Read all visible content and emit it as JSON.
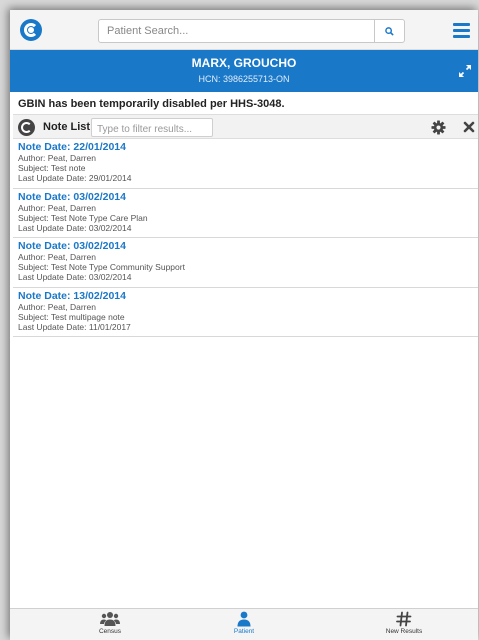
{
  "header": {
    "search_placeholder": "Patient Search...",
    "logo_icon": "app-logo-icon",
    "search_icon": "search-icon",
    "menu_icon": "hamburger-menu-icon"
  },
  "patient": {
    "name": "MARX, GROUCHO",
    "hcn": "HCN: 3986255713-ON",
    "expand_icon": "expand-icon"
  },
  "notice": "GBIN has been temporarily disabled per HHS-3048.",
  "note_list": {
    "title": "Note List",
    "filter_placeholder": "Type to filter results...",
    "settings_icon": "gear-icon",
    "close_icon": "close-icon",
    "notes": [
      {
        "date": "Note Date: 22/01/2014",
        "author": "Author: Peat, Darren",
        "subject": "Subject: Test note",
        "updated": "Last Update Date: 29/01/2014"
      },
      {
        "date": "Note Date: 03/02/2014",
        "author": "Author: Peat, Darren",
        "subject": "Subject: Test Note Type Care Plan",
        "updated": "Last Update Date: 03/02/2014"
      },
      {
        "date": "Note Date: 03/02/2014",
        "author": "Author: Peat, Darren",
        "subject": "Subject: Test Note Type Community Support",
        "updated": "Last Update Date: 03/02/2014"
      },
      {
        "date": "Note Date: 13/02/2014",
        "author": "Author: Peat, Darren",
        "subject": "Subject: Test multipage note",
        "updated": "Last Update Date: 11/01/2017"
      }
    ]
  },
  "bottom_nav": [
    {
      "label": "Census",
      "icon": "users-icon",
      "active": false
    },
    {
      "label": "Patient",
      "icon": "user-icon",
      "active": true
    },
    {
      "label": "New Results",
      "icon": "hashtag-icon",
      "active": false
    }
  ],
  "colors": {
    "accent": "#1a78c9",
    "banner_bg": "#1a78c9",
    "toolbar_bg": "#f4f4f4"
  }
}
